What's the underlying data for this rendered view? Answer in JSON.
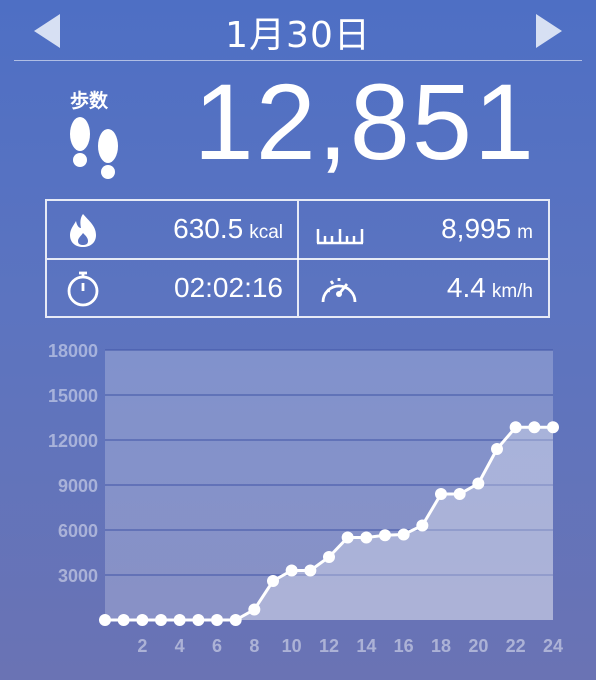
{
  "header": {
    "date": "1月30日"
  },
  "steps": {
    "label": "歩数",
    "value": "12,851"
  },
  "stats": {
    "calories": {
      "value": "630.5",
      "unit": "kcal"
    },
    "distance": {
      "value": "8,995",
      "unit": "m"
    },
    "duration": {
      "value": "02:02:16",
      "unit": ""
    },
    "speed": {
      "value": "4.4",
      "unit": "km/h"
    }
  },
  "chart_data": {
    "type": "area",
    "x": [
      0,
      1,
      2,
      3,
      4,
      5,
      6,
      7,
      8,
      9,
      10,
      11,
      12,
      13,
      14,
      15,
      16,
      17,
      18,
      19,
      20,
      21,
      22,
      23,
      24
    ],
    "values": [
      0,
      0,
      0,
      0,
      0,
      0,
      0,
      0,
      700,
      2600,
      3300,
      3300,
      4200,
      5500,
      5500,
      5650,
      5700,
      6300,
      8400,
      8400,
      9100,
      11400,
      12851,
      12851,
      12851
    ],
    "y_ticks": [
      "3000",
      "6000",
      "9000",
      "12000",
      "15000",
      "18000"
    ],
    "x_ticks": [
      "2",
      "4",
      "6",
      "8",
      "10",
      "12",
      "14",
      "16",
      "18",
      "20",
      "22",
      "24"
    ],
    "ylim": [
      0,
      18000
    ],
    "xlim": [
      0,
      24
    ],
    "grid": true
  }
}
